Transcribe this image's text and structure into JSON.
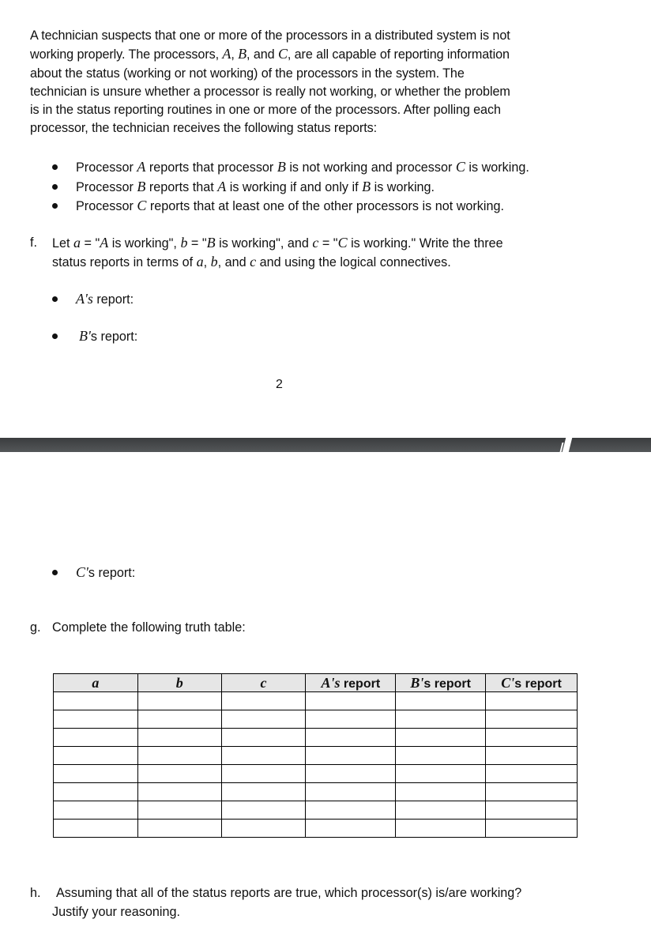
{
  "intro": {
    "lines": [
      "A technician suspects that one or more of the processors in a distributed system is not",
      "working properly.  The processors, A, B, and C, are all capable of reporting information",
      "about the status (working or not working) of the processors in the system.  The",
      "technician is unsure whether a processor is really not working, or whether the problem",
      "is in the status reporting routines in one or more of the processors.  After polling each",
      "processor, the technician receives the following status reports:"
    ]
  },
  "reports": [
    {
      "pre": "Processor ",
      "v1": "A",
      "mid1": " reports that processor ",
      "v2": "B",
      "mid2": " is not working and processor ",
      "v3": "C",
      "post": " is working."
    },
    {
      "pre": "Processor ",
      "v1": "B",
      "mid1": " reports that ",
      "v2": "A",
      "mid2": " is working if and only if ",
      "v3": "B",
      "post": " is working."
    },
    {
      "pre": "Processor ",
      "v1": "C",
      "mid1": " reports that at least one of the other processors is not working.",
      "v2": "",
      "mid2": "",
      "v3": "",
      "post": ""
    }
  ],
  "question_f": {
    "label": "f.",
    "line1_parts": [
      "Let ",
      "a",
      " = \"",
      "A",
      " is working\", ",
      "b",
      " = \"",
      "B",
      " is working\", and ",
      "c",
      " = \"",
      "C",
      " is working.\"  Write the three"
    ],
    "line2_parts": [
      "status reports in terms of ",
      "a",
      ", ",
      "b",
      ", and ",
      "c",
      " and using the logical connectives."
    ],
    "answers": [
      {
        "var": "A's",
        "label": " report:"
      },
      {
        "var": "B'",
        "label": "s report:"
      },
      {
        "var": "C'",
        "label": "s report:"
      }
    ]
  },
  "page_number": "2",
  "question_g": {
    "label": "g.",
    "text": "Complete the following truth table:"
  },
  "truth_table": {
    "headers": [
      {
        "math": "a",
        "text": ""
      },
      {
        "math": "b",
        "text": ""
      },
      {
        "math": "c",
        "text": ""
      },
      {
        "math": "A's",
        "text": " report"
      },
      {
        "math": "B'",
        "text": "s report"
      },
      {
        "math": "C'",
        "text": "s report"
      }
    ],
    "rows": [
      [
        "",
        "",
        "",
        "",
        "",
        ""
      ],
      [
        "",
        "",
        "",
        "",
        "",
        ""
      ],
      [
        "",
        "",
        "",
        "",
        "",
        ""
      ],
      [
        "",
        "",
        "",
        "",
        "",
        ""
      ],
      [
        "",
        "",
        "",
        "",
        "",
        ""
      ],
      [
        "",
        "",
        "",
        "",
        "",
        ""
      ],
      [
        "",
        "",
        "",
        "",
        "",
        ""
      ],
      [
        "",
        "",
        "",
        "",
        "",
        ""
      ]
    ]
  },
  "question_h": {
    "label": "h.",
    "line1": "Assuming that all of the status reports are true, which processor(s) is/are working?",
    "line2": "Justify your reasoning."
  }
}
